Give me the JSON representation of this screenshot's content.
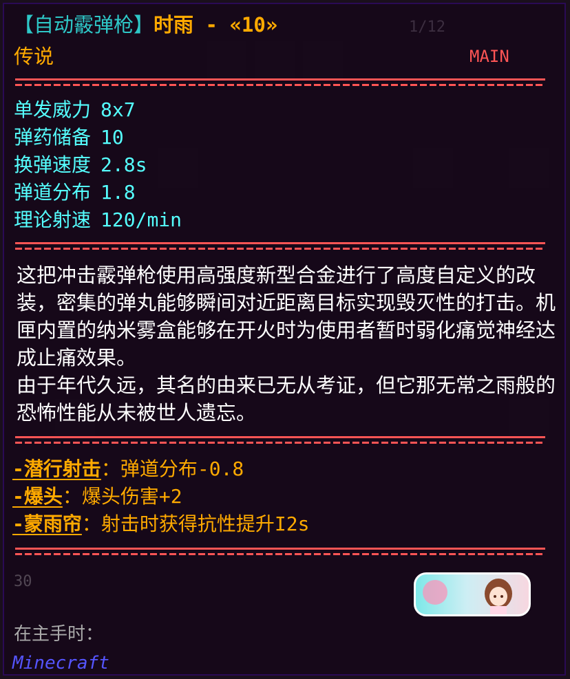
{
  "title": {
    "bracket_text": "【自动霰弹枪】",
    "name": "时雨",
    "separator": "-",
    "level": "«10»"
  },
  "page_indicator": "1/12",
  "rarity": "传说",
  "slot_tag": "MAIN",
  "stats": [
    {
      "label": "单发威力",
      "value": "8x7"
    },
    {
      "label": "弹药储备",
      "value": "10"
    },
    {
      "label": "换弹速度",
      "value": "2.8s"
    },
    {
      "label": "弹道分布",
      "value": "1.8"
    },
    {
      "label": "理论射速",
      "value": "120/min"
    }
  ],
  "lore": [
    "这把冲击霰弹枪使用高强度新型合金进行了高度自定义的改装，密集的弹丸能够瞬间对近距离目标实现毁灭性的打击。机匣内置的纳米雾盒能够在开火时为使用者暂时弱化痛觉神经达成止痛效果。",
    "由于年代久远，其名的由来已无从考证，但它那无常之雨般的恐怖性能从未被世人遗忘。"
  ],
  "perks": [
    {
      "name": "-潜行射击",
      "effect": "：弹道分布-0.8"
    },
    {
      "name": "-爆头",
      "effect": "：爆头伤害+2"
    },
    {
      "name": "-蒙雨帘",
      "effect": "：射击时获得抗性提升I2s"
    }
  ],
  "item_count": "30",
  "hand_label": "在主手时：",
  "mod_name": "Minecraft",
  "colors": {
    "cyan": "#55ffff",
    "gold": "#ffaa00",
    "red": "#ff5555",
    "white": "#ffffff",
    "gray": "#aaaaaa",
    "blue": "#5555ff"
  }
}
